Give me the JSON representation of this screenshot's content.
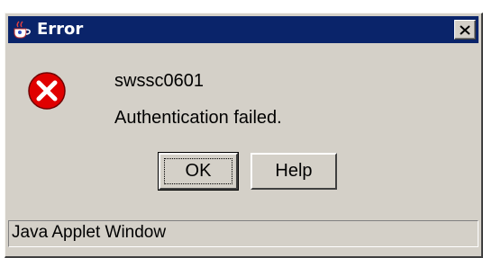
{
  "window": {
    "title": "Error",
    "title_icon": "java-cup-icon",
    "close_icon": "close-x-icon"
  },
  "dialog": {
    "icon": "error-icon",
    "message_code": "swssc0601",
    "message_text": "Authentication failed."
  },
  "buttons": {
    "ok_label": "OK",
    "help_label": "Help"
  },
  "status_bar": {
    "text": "Java Applet Window"
  },
  "colors": {
    "titlebar": "#0a246a",
    "window_face": "#d4d0c8",
    "error_red": "#e00000"
  }
}
